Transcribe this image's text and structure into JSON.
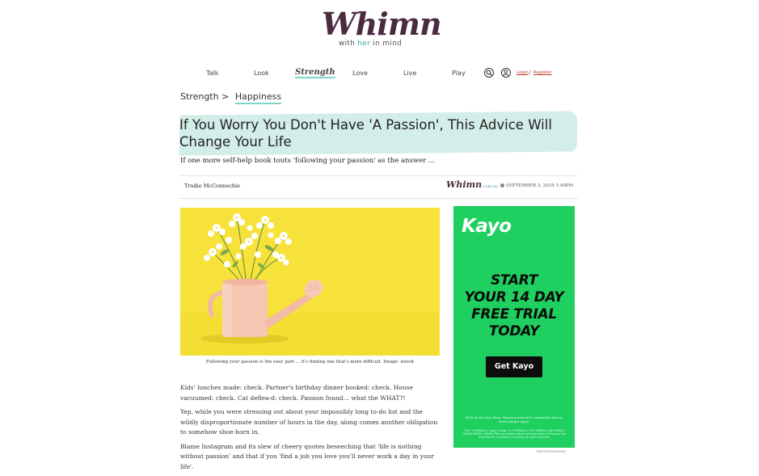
{
  "brand": {
    "wordmark": "Whimn",
    "tag_prefix": "with ",
    "tag_her": "her",
    "tag_suffix": " in mind"
  },
  "nav": {
    "items": [
      "Talk",
      "Look",
      "Strength",
      "Love",
      "Live",
      "Play"
    ],
    "active": "Strength",
    "login": "Login",
    "separator": "/",
    "register": "Register"
  },
  "breadcrumb": {
    "parent": "Strength",
    "separator": ">",
    "current": "Happiness"
  },
  "article": {
    "headline": "If You Worry You Don't Have 'A Passion', This Advice Will Change Your Life",
    "dek": "If one more self-help book touts 'following your passion' as the answer ...",
    "author": "Trudie McConnochie",
    "source_logo": "Whimn",
    "source_suffix": ".com.au",
    "date": "SEPTEMBER 3, 2019 1:49PM",
    "caption": "Following your passion is the easy part ... it's finding one that's more difficult. Image: istock",
    "paragraphs": [
      "Kids' lunches made: check. Partner's birthday dinner booked: check. House vacuumed: check. Cat deflea-d: check. Passion found… what the WHAT?!",
      "Yep, while you were stressing out about your impossibly long to-do list and the wildly disproportionate number of hours in the day, along comes another obligation to somehow shoe-horn in.",
      "Blame Instagram and its slew of cheery quotes beseeching that 'life is nothing without passion' and that if you 'find a job you love you'll never work a day in your life'."
    ]
  },
  "ad": {
    "logo": "Kayo",
    "headline": [
      "START",
      "YOUR 14 DAY",
      "FREE TRIAL",
      "TODAY"
    ],
    "button": "Get Kayo",
    "fine1": "$25/mth for Kayo Basic. Requires internet & compatible device. Data charges apply.",
    "fine2": "The F1 FORMULA 1 logo, F1 logo, F1, FORMULA 1, FIA FORMULA ONE WORLD CHAMPIONSHIP, GRAND PRIX and related marks are trade marks of Formula One Licensing BV, a Formula 1 company. All rights reserved.",
    "label": "Advertisement",
    "color": "#1fcf5f"
  },
  "colors": {
    "accent_teal": "#7ed6c8",
    "highlight": "#d3ede8",
    "brand_plum": "#4a2b3f",
    "link_red": "#c0392b"
  }
}
